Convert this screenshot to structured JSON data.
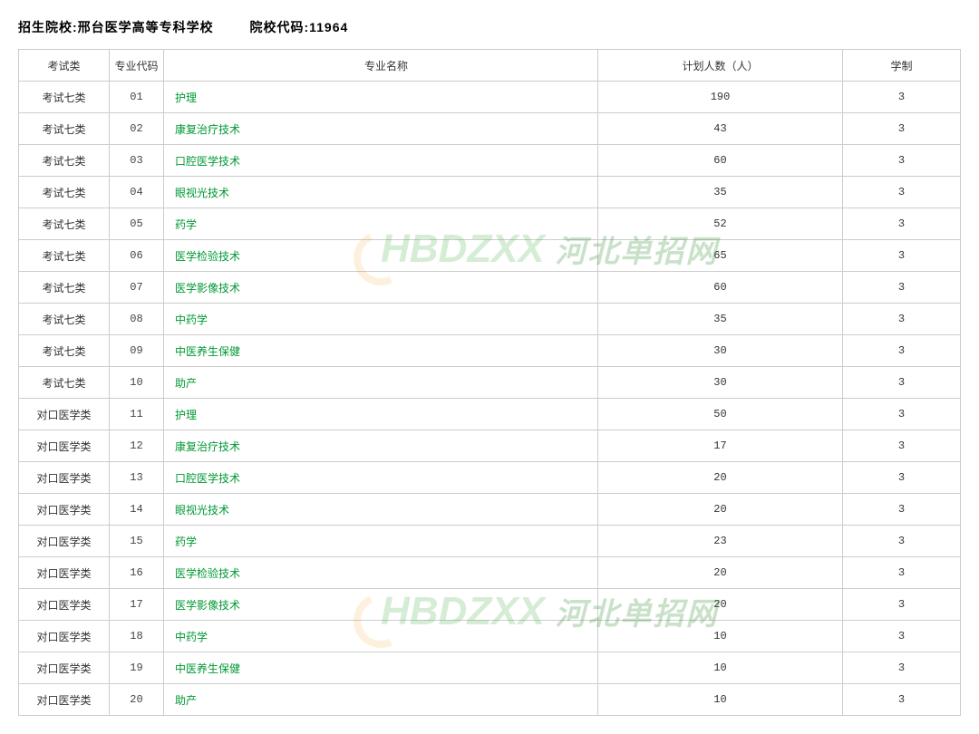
{
  "header": {
    "school_label": "招生院校:",
    "school_name": "邢台医学高等专科学校",
    "code_label": "院校代码:",
    "code_value": "11964"
  },
  "columns": {
    "type": "考试类",
    "code": "专业代码",
    "name": "专业名称",
    "plan": "计划人数（人）",
    "dur": "学制"
  },
  "rows": [
    {
      "type": "考试七类",
      "code": "01",
      "name": "护理",
      "plan": "190",
      "dur": "3"
    },
    {
      "type": "考试七类",
      "code": "02",
      "name": "康复治疗技术",
      "plan": "43",
      "dur": "3"
    },
    {
      "type": "考试七类",
      "code": "03",
      "name": "口腔医学技术",
      "plan": "60",
      "dur": "3"
    },
    {
      "type": "考试七类",
      "code": "04",
      "name": "眼视光技术",
      "plan": "35",
      "dur": "3"
    },
    {
      "type": "考试七类",
      "code": "05",
      "name": "药学",
      "plan": "52",
      "dur": "3"
    },
    {
      "type": "考试七类",
      "code": "06",
      "name": "医学检验技术",
      "plan": "65",
      "dur": "3"
    },
    {
      "type": "考试七类",
      "code": "07",
      "name": "医学影像技术",
      "plan": "60",
      "dur": "3"
    },
    {
      "type": "考试七类",
      "code": "08",
      "name": "中药学",
      "plan": "35",
      "dur": "3"
    },
    {
      "type": "考试七类",
      "code": "09",
      "name": "中医养生保健",
      "plan": "30",
      "dur": "3"
    },
    {
      "type": "考试七类",
      "code": "10",
      "name": "助产",
      "plan": "30",
      "dur": "3"
    },
    {
      "type": "对口医学类",
      "code": "11",
      "name": "护理",
      "plan": "50",
      "dur": "3"
    },
    {
      "type": "对口医学类",
      "code": "12",
      "name": "康复治疗技术",
      "plan": "17",
      "dur": "3"
    },
    {
      "type": "对口医学类",
      "code": "13",
      "name": "口腔医学技术",
      "plan": "20",
      "dur": "3"
    },
    {
      "type": "对口医学类",
      "code": "14",
      "name": "眼视光技术",
      "plan": "20",
      "dur": "3"
    },
    {
      "type": "对口医学类",
      "code": "15",
      "name": "药学",
      "plan": "23",
      "dur": "3"
    },
    {
      "type": "对口医学类",
      "code": "16",
      "name": "医学检验技术",
      "plan": "20",
      "dur": "3"
    },
    {
      "type": "对口医学类",
      "code": "17",
      "name": "医学影像技术",
      "plan": "20",
      "dur": "3"
    },
    {
      "type": "对口医学类",
      "code": "18",
      "name": "中药学",
      "plan": "10",
      "dur": "3"
    },
    {
      "type": "对口医学类",
      "code": "19",
      "name": "中医养生保健",
      "plan": "10",
      "dur": "3"
    },
    {
      "type": "对口医学类",
      "code": "20",
      "name": "助产",
      "plan": "10",
      "dur": "3"
    }
  ],
  "watermark": {
    "logo": "HBDZXX",
    "text": "河北单招网"
  }
}
